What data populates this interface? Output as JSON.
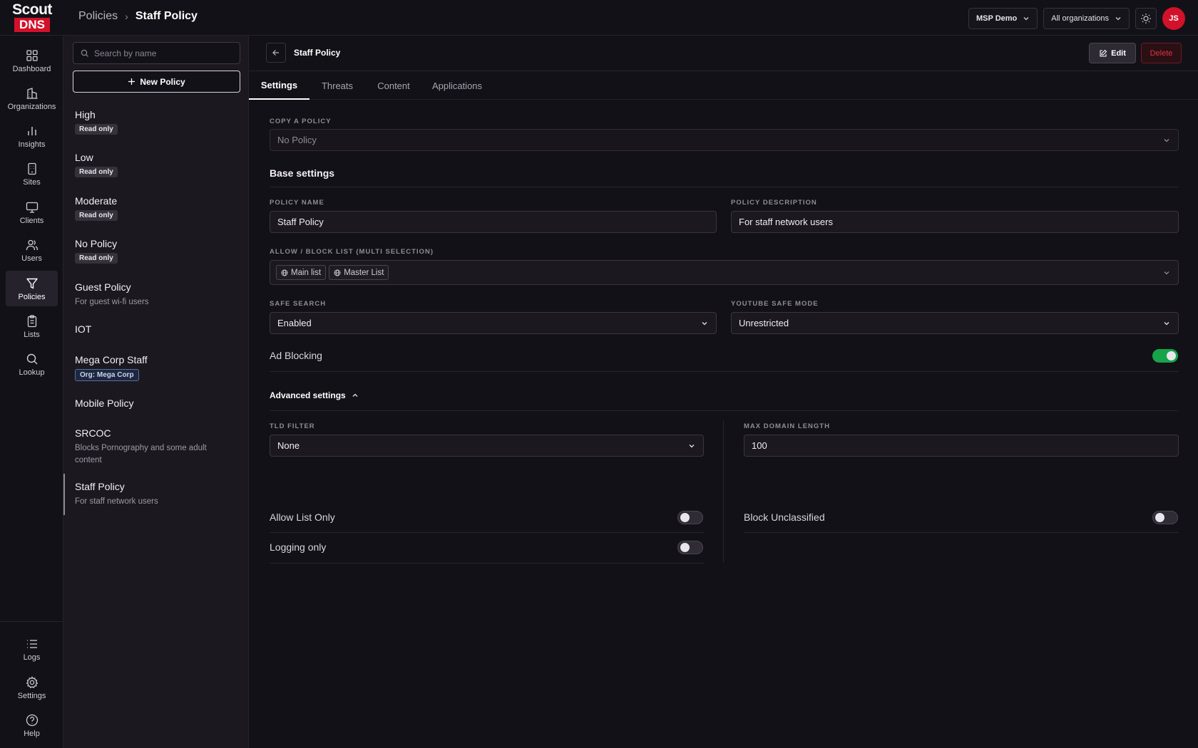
{
  "brand": {
    "logo_top": "Scout",
    "logo_bottom": "DNS",
    "accent": "#d2112a"
  },
  "breadcrumb": {
    "parent": "Policies",
    "current": "Staff Policy"
  },
  "topbar": {
    "tenant": "MSP Demo",
    "org_filter": "All organizations",
    "theme_icon": "sun-icon",
    "avatar_initials": "JS"
  },
  "nav": {
    "items": [
      {
        "label": "Dashboard",
        "icon": "dashboard-icon"
      },
      {
        "label": "Organizations",
        "icon": "building-icon"
      },
      {
        "label": "Insights",
        "icon": "bar-chart-icon"
      },
      {
        "label": "Sites",
        "icon": "site-icon"
      },
      {
        "label": "Clients",
        "icon": "monitor-icon"
      },
      {
        "label": "Users",
        "icon": "users-icon"
      },
      {
        "label": "Policies",
        "icon": "filter-icon",
        "active": true
      },
      {
        "label": "Lists",
        "icon": "clipboard-icon"
      },
      {
        "label": "Lookup",
        "icon": "search-icon"
      }
    ],
    "bottom": [
      {
        "label": "Logs",
        "icon": "list-icon"
      },
      {
        "label": "Settings",
        "icon": "gear-icon"
      },
      {
        "label": "Help",
        "icon": "help-icon"
      }
    ]
  },
  "policy_list": {
    "search_placeholder": "Search by name",
    "new_button": "New Policy",
    "items": [
      {
        "name": "High",
        "badge": "Read only"
      },
      {
        "name": "Low",
        "badge": "Read only"
      },
      {
        "name": "Moderate",
        "badge": "Read only"
      },
      {
        "name": "No Policy",
        "badge": "Read only"
      },
      {
        "name": "Guest Policy",
        "desc": "For guest wi-fi users"
      },
      {
        "name": "IOT"
      },
      {
        "name": "Mega Corp Staff",
        "org_badge": "Org: Mega Corp"
      },
      {
        "name": "Mobile Policy"
      },
      {
        "name": "SRCOC",
        "desc": "Blocks Pornography and some adult content"
      },
      {
        "name": "Staff Policy",
        "desc": "For staff network users",
        "selected": true
      }
    ]
  },
  "detail": {
    "title": "Staff Policy",
    "edit_label": "Edit",
    "delete_label": "Delete",
    "tabs": [
      "Settings",
      "Threats",
      "Content",
      "Applications"
    ],
    "copy_policy": {
      "label": "COPY A POLICY",
      "placeholder": "No Policy"
    },
    "base_settings_title": "Base settings",
    "policy_name": {
      "label": "POLICY NAME",
      "value": "Staff Policy"
    },
    "policy_description": {
      "label": "POLICY DESCRIPTION",
      "value": "For staff network users"
    },
    "allow_block": {
      "label": "ALLOW / BLOCK LIST (MULTI SELECTION)",
      "chips": [
        "Main list",
        "Master List"
      ]
    },
    "safe_search": {
      "label": "SAFE SEARCH",
      "value": "Enabled"
    },
    "youtube_safe_mode": {
      "label": "YOUTUBE SAFE MODE",
      "value": "Unrestricted"
    },
    "ad_blocking": {
      "label": "Ad Blocking",
      "on": true
    },
    "advanced_title": "Advanced settings",
    "tld_filter": {
      "label": "TLD FILTER",
      "value": "None"
    },
    "max_domain_length": {
      "label": "MAX DOMAIN LENGTH",
      "value": "100"
    },
    "allow_list_only": {
      "label": "Allow List Only",
      "on": false
    },
    "block_unclassified": {
      "label": "Block Unclassified",
      "on": false
    },
    "logging_only": {
      "label": "Logging only",
      "on": false
    }
  }
}
